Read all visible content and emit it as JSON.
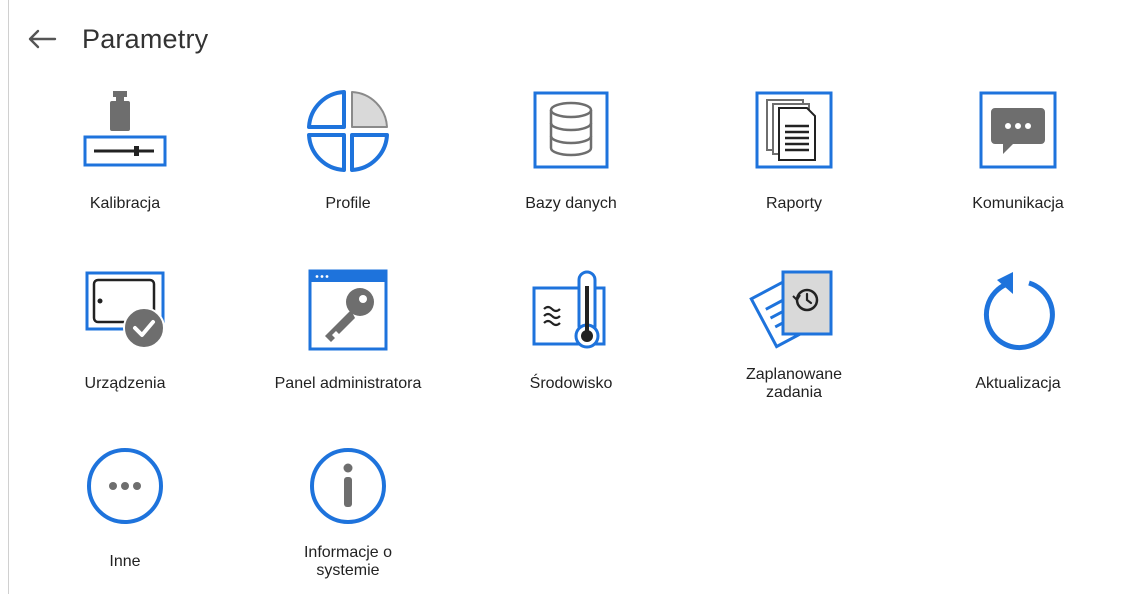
{
  "header": {
    "title": "Parametry",
    "back_icon": "arrow-left-icon"
  },
  "colors": {
    "accent": "#1e73dc",
    "icon_gray": "#6e6e6e",
    "text": "#222222"
  },
  "tiles": [
    {
      "label": "Kalibracja",
      "icon": "calibration-weight-icon"
    },
    {
      "label": "Profile",
      "icon": "profile-pie-icon"
    },
    {
      "label": "Bazy danych",
      "icon": "database-icon"
    },
    {
      "label": "Raporty",
      "icon": "reports-documents-icon"
    },
    {
      "label": "Komunikacja",
      "icon": "chat-bubble-icon"
    },
    {
      "label": "Urządzenia",
      "icon": "device-check-icon"
    },
    {
      "label": "Panel administratora",
      "icon": "admin-key-icon"
    },
    {
      "label": "Środowisko",
      "icon": "thermometer-icon"
    },
    {
      "label": "Zaplanowane\nzadania",
      "icon": "scheduled-tasks-icon"
    },
    {
      "label": "Aktualizacja",
      "icon": "update-refresh-icon"
    },
    {
      "label": "Inne",
      "icon": "more-dots-icon"
    },
    {
      "label": "Informacje o\nsystemie",
      "icon": "info-icon"
    }
  ]
}
